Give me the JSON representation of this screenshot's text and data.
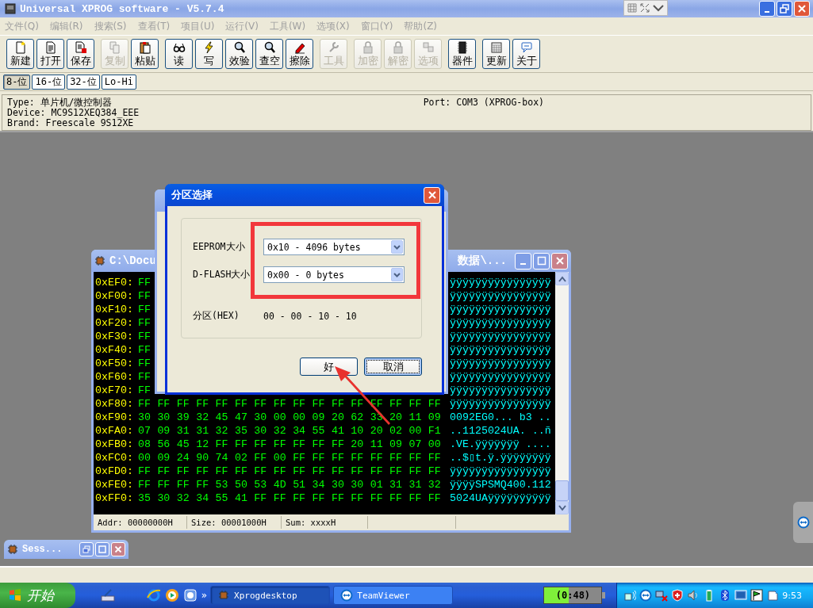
{
  "window": {
    "title": "Universal XPROG software - V5.7.4"
  },
  "menu": [
    "文件(Q)",
    "编辑(R)",
    "搜索(S)",
    "查看(T)",
    "项目(U)",
    "运行(V)",
    "工具(W)",
    "选项(X)",
    "窗口(Y)",
    "帮助(Z)"
  ],
  "toolbar": [
    [
      {
        "label": "新建",
        "kind": "new",
        "disabled": false
      },
      {
        "label": "打开",
        "kind": "open",
        "disabled": false
      },
      {
        "label": "保存",
        "kind": "save",
        "disabled": false
      }
    ],
    [
      {
        "label": "复制",
        "kind": "copy",
        "disabled": true
      },
      {
        "label": "粘贴",
        "kind": "paste",
        "disabled": false
      }
    ],
    [
      {
        "label": "读",
        "kind": "glasses",
        "disabled": false
      },
      {
        "label": "写",
        "kind": "bolt",
        "disabled": false
      },
      {
        "label": "效验",
        "kind": "magnifier",
        "disabled": false
      },
      {
        "label": "查空",
        "kind": "magnifier",
        "disabled": false
      },
      {
        "label": "擦除",
        "kind": "eraser",
        "disabled": false
      }
    ],
    [
      {
        "label": "工具",
        "kind": "wrench",
        "disabled": true
      }
    ],
    [
      {
        "label": "加密",
        "kind": "lock",
        "disabled": true
      },
      {
        "label": "解密",
        "kind": "lock",
        "disabled": true
      },
      {
        "label": "选项",
        "kind": "options",
        "disabled": true
      }
    ],
    [
      {
        "label": "器件",
        "kind": "chip",
        "disabled": false
      }
    ],
    [
      {
        "label": "更新",
        "kind": "calendar",
        "disabled": false
      },
      {
        "label": "关于",
        "kind": "bubble",
        "disabled": false
      }
    ]
  ],
  "width_buttons": [
    {
      "label": "8-位",
      "selected": true
    },
    {
      "label": "16-位",
      "selected": false
    },
    {
      "label": "32-位",
      "selected": false
    },
    {
      "label": "Lo-Hi",
      "selected": false
    }
  ],
  "info": {
    "type": "Type: 单片机/微控制器",
    "device": "Device: MC9S12XEQ384_EEE",
    "brand": "Brand: Freescale 9S12XE",
    "port": "Port: COM3 (XPROG-box)"
  },
  "hex_window": {
    "title_left": "C:\\Docu",
    "title_right": "数据\\...",
    "rows": [
      {
        "address": "0xEF0:",
        "bytes": [
          "FF"
        ],
        "ascii": "ÿÿÿÿÿÿÿÿÿÿÿÿÿÿÿÿ"
      },
      {
        "address": "0xF00:",
        "bytes": [
          "FF"
        ],
        "ascii": "ÿÿÿÿÿÿÿÿÿÿÿÿÿÿÿÿ"
      },
      {
        "address": "0xF10:",
        "bytes": [
          "FF"
        ],
        "ascii": "ÿÿÿÿÿÿÿÿÿÿÿÿÿÿÿÿ"
      },
      {
        "address": "0xF20:",
        "bytes": [
          "FF"
        ],
        "ascii": "ÿÿÿÿÿÿÿÿÿÿÿÿÿÿÿÿ"
      },
      {
        "address": "0xF30:",
        "bytes": [
          "FF"
        ],
        "ascii": "ÿÿÿÿÿÿÿÿÿÿÿÿÿÿÿÿ"
      },
      {
        "address": "0xF40:",
        "bytes": [
          "FF"
        ],
        "ascii": "ÿÿÿÿÿÿÿÿÿÿÿÿÿÿÿÿ"
      },
      {
        "address": "0xF50:",
        "bytes": [
          "FF"
        ],
        "ascii": "ÿÿÿÿÿÿÿÿÿÿÿÿÿÿÿÿ"
      },
      {
        "address": "0xF60:",
        "bytes": [
          "FF"
        ],
        "ascii": "ÿÿÿÿÿÿÿÿÿÿÿÿÿÿÿÿ"
      },
      {
        "address": "0xF70:",
        "bytes": [
          "FF"
        ],
        "ascii": "ÿÿÿÿÿÿÿÿÿÿÿÿÿÿÿÿ"
      },
      {
        "address": "0xF80:",
        "bytes": [
          "FF",
          "FF",
          "FF",
          "FF",
          "FF",
          "FF",
          "FF",
          "FF",
          "FF",
          "FF",
          "FF",
          "FF",
          "FF",
          "FF",
          "FF",
          "FF"
        ],
        "ascii": "ÿÿÿÿÿÿÿÿÿÿÿÿÿÿÿÿ"
      },
      {
        "address": "0xF90:",
        "bytes": [
          "30",
          "30",
          "39",
          "32",
          "45",
          "47",
          "30",
          "00",
          "00",
          "09",
          "20",
          "62",
          "33",
          "20",
          "11",
          "09"
        ],
        "ascii": "0092EG0... b3 .."
      },
      {
        "address": "0xFA0:",
        "bytes": [
          "07",
          "09",
          "31",
          "31",
          "32",
          "35",
          "30",
          "32",
          "34",
          "55",
          "41",
          "10",
          "20",
          "02",
          "00",
          "F1"
        ],
        "ascii": "..1125024UA. ..ñ"
      },
      {
        "address": "0xFB0:",
        "bytes": [
          "08",
          "56",
          "45",
          "12",
          "FF",
          "FF",
          "FF",
          "FF",
          "FF",
          "FF",
          "FF",
          "20",
          "11",
          "09",
          "07",
          "00"
        ],
        "ascii": ".VE.ÿÿÿÿÿÿÿ ...."
      },
      {
        "address": "0xFC0:",
        "bytes": [
          "00",
          "09",
          "24",
          "90",
          "74",
          "02",
          "FF",
          "00",
          "FF",
          "FF",
          "FF",
          "FF",
          "FF",
          "FF",
          "FF",
          "FF"
        ],
        "ascii": "..$▯t.ÿ.ÿÿÿÿÿÿÿÿ"
      },
      {
        "address": "0xFD0:",
        "bytes": [
          "FF",
          "FF",
          "FF",
          "FF",
          "FF",
          "FF",
          "FF",
          "FF",
          "FF",
          "FF",
          "FF",
          "FF",
          "FF",
          "FF",
          "FF",
          "FF"
        ],
        "ascii": "ÿÿÿÿÿÿÿÿÿÿÿÿÿÿÿÿ"
      },
      {
        "address": "0xFE0:",
        "bytes": [
          "FF",
          "FF",
          "FF",
          "FF",
          "53",
          "50",
          "53",
          "4D",
          "51",
          "34",
          "30",
          "30",
          "01",
          "31",
          "31",
          "32"
        ],
        "ascii": "ÿÿÿÿSPSMQ400.112"
      },
      {
        "address": "0xFF0:",
        "bytes": [
          "35",
          "30",
          "32",
          "34",
          "55",
          "41",
          "FF",
          "FF",
          "FF",
          "FF",
          "FF",
          "FF",
          "FF",
          "FF",
          "FF",
          "FF"
        ],
        "ascii": "5024UAÿÿÿÿÿÿÿÿÿÿ"
      }
    ],
    "status": [
      "Addr: 00000000H",
      "Size: 00001000H",
      "Sum: xxxxH"
    ]
  },
  "dialog": {
    "title": "分区选择",
    "fields": [
      {
        "label": "EEPROM大小",
        "value": "0x10 - 4096 bytes"
      },
      {
        "label": "D-FLASH大小",
        "value": "0x00 - 0 bytes"
      }
    ],
    "partition_label": "分区(HEX)",
    "partition_value": "00 - 00 - 10 - 10",
    "buttons": [
      {
        "label": "好",
        "focused": false
      },
      {
        "label": "取消",
        "focused": true
      }
    ]
  },
  "minimized_window": {
    "title": "Sess..."
  },
  "taskbar": {
    "start": "开始",
    "more": "»",
    "tasks": [
      {
        "label": "Xprogdesktop",
        "selected": true
      },
      {
        "label": "TeamViewer",
        "selected": false
      }
    ],
    "timer": {
      "label": "(0:48)",
      "level": 0.42
    },
    "clock": "9:53"
  }
}
